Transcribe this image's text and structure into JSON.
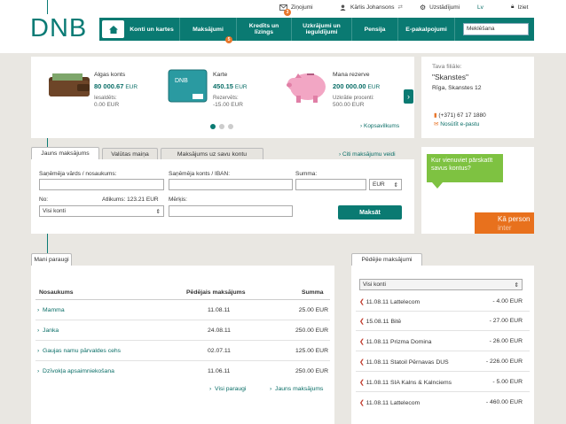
{
  "header": {
    "logo": "DNB",
    "messages_label": "Ziņojumi",
    "messages_count": "3",
    "user_name": "Kārlis Johansons",
    "settings_label": "Uzstādījumi",
    "language": "Lv",
    "logout_label": "Iziet"
  },
  "nav": {
    "items": [
      "Konti un kartes",
      "Maksājumi",
      "Kredīts un līzings",
      "Uzkrājumi un ieguldījumi",
      "Pensija",
      "E-pakalpojumi"
    ],
    "payments_badge": "5",
    "search_placeholder": "Meklēšana"
  },
  "accounts": [
    {
      "title": "Algas konts",
      "value": "80 000.67",
      "currency": "EUR",
      "sub_label": "Iesaldēts:",
      "sub_value": "0.00 EUR"
    },
    {
      "title": "Karte",
      "value": "450.15",
      "currency": "EUR",
      "sub_label": "Rezervēts:",
      "sub_value": "-15.00 EUR"
    },
    {
      "title": "Mana rezerve",
      "value": "200 000.00",
      "currency": "EUR",
      "sub_label": "Uzkrātie procenti:",
      "sub_value": "500.00 EUR"
    }
  ],
  "summary_link": "Kopsavilkums",
  "branch": {
    "title": "Tava filiāle:",
    "name": "\"Skanstes\"",
    "address": "Rīga, Skanstes 12",
    "phone": "(+371) 67 17 1880",
    "email_link": "Nosūtīt e-pastu"
  },
  "payment_tabs": [
    "Jauns maksājums",
    "Valūtas maiņa",
    "Maksājums uz savu kontu"
  ],
  "other_payments_link": "Citi maksājumu veidi",
  "form": {
    "receiver_label": "Saņēmēja vārds / nosaukums:",
    "account_label": "Saņēmēja konts / IBAN:",
    "amount_label": "Summa:",
    "currency": "EUR",
    "from_label": "No:",
    "balance_label": "Atlikums: 123.21 EUR",
    "from_value": "Visi konti",
    "purpose_label": "Mērķis:",
    "pay_button": "Maksāt"
  },
  "promo": {
    "bubble": "Kur vienuviet pārskatīt savus kontus?",
    "orange": "Kā person",
    "orange2": "inter"
  },
  "templates": {
    "tab": "Mani paraugi",
    "col_name": "Nosaukums",
    "col_last": "Pēdējais maksājums",
    "col_sum": "Summa",
    "rows": [
      {
        "name": "Mamma",
        "date": "11.08.11",
        "sum": "25.00 EUR"
      },
      {
        "name": "Janka",
        "date": "24.08.11",
        "sum": "250.00 EUR"
      },
      {
        "name": "Gaujas namu pārvaldes cehs",
        "date": "02.07.11",
        "sum": "125.00 EUR"
      },
      {
        "name": "Dzīvokļa apsaimniekošana",
        "date": "11.06.11",
        "sum": "250.00 EUR"
      }
    ],
    "all_link": "Visi paraugi",
    "new_link": "Jauns maksājums"
  },
  "recent": {
    "tab": "Pēdējie maksājumi",
    "filter": "Visi konti",
    "rows": [
      {
        "date": "11.08.11",
        "name": "Lattelecom",
        "sum": "- 4.00 EUR"
      },
      {
        "date": "15.08.11",
        "name": "Bitē",
        "sum": "- 27.00 EUR"
      },
      {
        "date": "11.08.11",
        "name": "Prizma Domina",
        "sum": "- 26.00 EUR"
      },
      {
        "date": "11.08.11",
        "name": "Statoil Pērnavas DUS",
        "sum": "- 226.00 EUR"
      },
      {
        "date": "11.08.11",
        "name": "SIA Kalns & Kalnciems",
        "sum": "- 5.00 EUR"
      },
      {
        "date": "11.08.11",
        "name": "Lattelecom",
        "sum": "- 460.00 EUR"
      }
    ]
  },
  "colors": {
    "brand": "#0a7a72",
    "accent": "#e8762b",
    "promo_green": "#7ec241"
  }
}
